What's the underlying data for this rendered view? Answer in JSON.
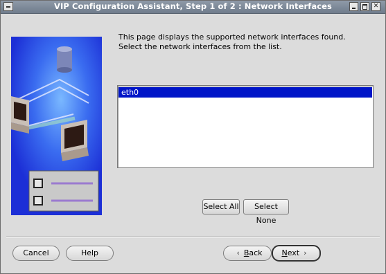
{
  "window": {
    "title": "VIP Configuration Assistant, Step 1 of 2 : Network Interfaces"
  },
  "description": "This page displays the supported network interfaces found. Select the network interfaces from the list.",
  "interfaces": {
    "items": [
      "eth0"
    ],
    "selected": "eth0"
  },
  "selection_buttons": {
    "select_all": "Select All",
    "select_none": "Select None"
  },
  "footer": {
    "cancel": "Cancel",
    "help": "Help",
    "back_prefix": "B",
    "back_rest": "ack",
    "next_prefix": "N",
    "next_rest": "ext"
  },
  "colors": {
    "title_bar": "#7b8797",
    "selection": "#0015c8",
    "illustration_blue": "#1c2fd6"
  },
  "icons": [
    "window-menu-icon",
    "minimize-icon",
    "maximize-icon",
    "close-icon",
    "back-chevron-icon",
    "next-chevron-icon"
  ]
}
